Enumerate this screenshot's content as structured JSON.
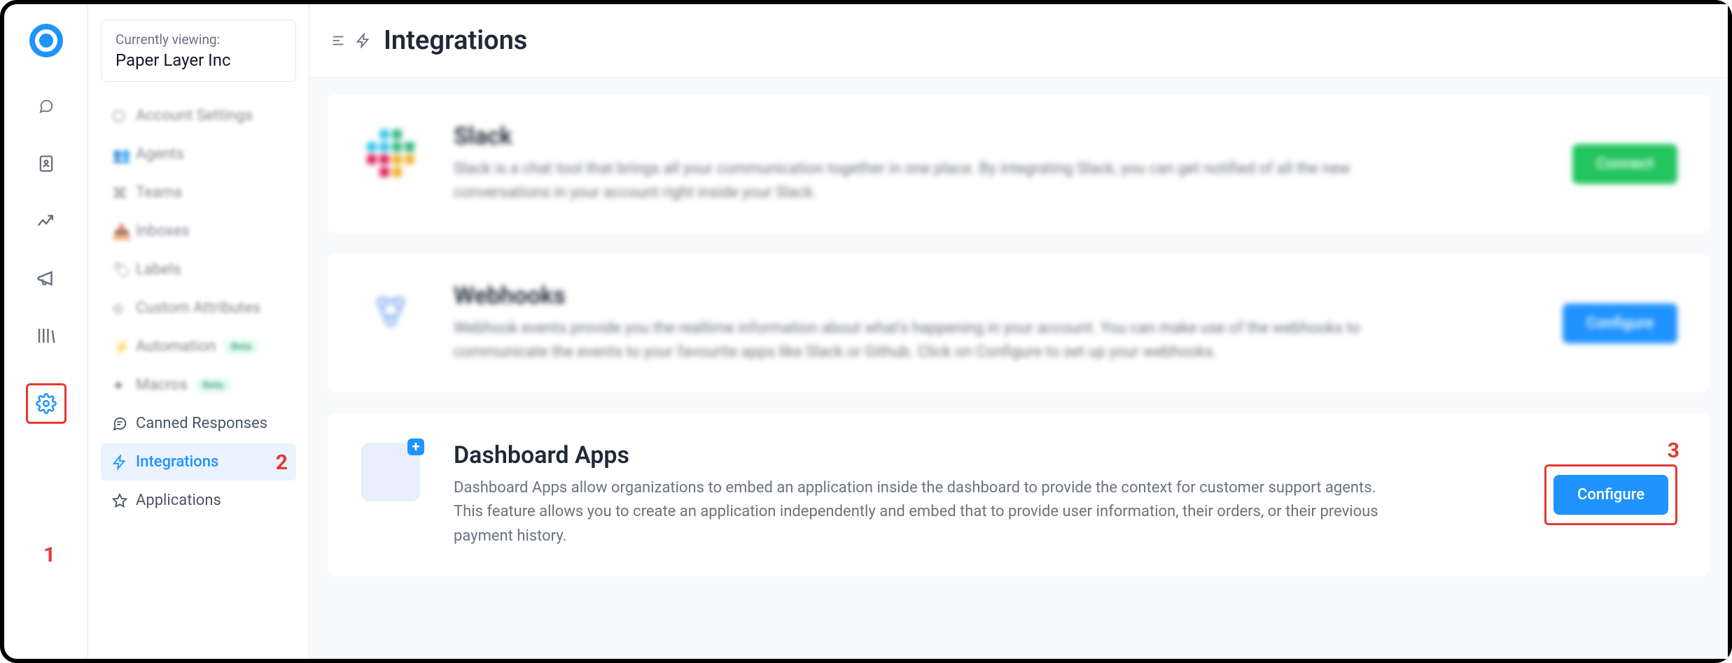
{
  "account": {
    "label": "Currently viewing:",
    "name": "Paper Layer Inc"
  },
  "page": {
    "title": "Integrations"
  },
  "sidebar": {
    "items": [
      {
        "label": "Account Settings"
      },
      {
        "label": "Agents"
      },
      {
        "label": "Teams"
      },
      {
        "label": "Inboxes"
      },
      {
        "label": "Labels"
      },
      {
        "label": "Custom Attributes"
      },
      {
        "label": "Automation",
        "badge": "Beta"
      },
      {
        "label": "Macros",
        "badge": "Beta"
      },
      {
        "label": "Canned Responses"
      },
      {
        "label": "Integrations"
      },
      {
        "label": "Applications"
      }
    ]
  },
  "cards": [
    {
      "title": "Slack",
      "desc": "Slack is a chat tool that brings all your communication together in one place. By integrating Slack, you can get notified of all the new conversations in your account right inside your Slack.",
      "button": "Connect"
    },
    {
      "title": "Webhooks",
      "desc": "Webhook events provide you the realtime information about what's happening in your account. You can make use of the webhooks to communicate the events to your favourite apps like Slack or Github. Click on Configure to set up your webhooks.",
      "button": "Configure"
    },
    {
      "title": "Dashboard Apps",
      "desc": "Dashboard Apps allow organizations to embed an application inside the dashboard to provide the context for customer support agents. This feature allows you to create an application independently and embed that to provide user information, their orders, or their previous payment history.",
      "button": "Configure"
    }
  ],
  "callouts": {
    "one": "1",
    "two": "2",
    "three": "3"
  }
}
